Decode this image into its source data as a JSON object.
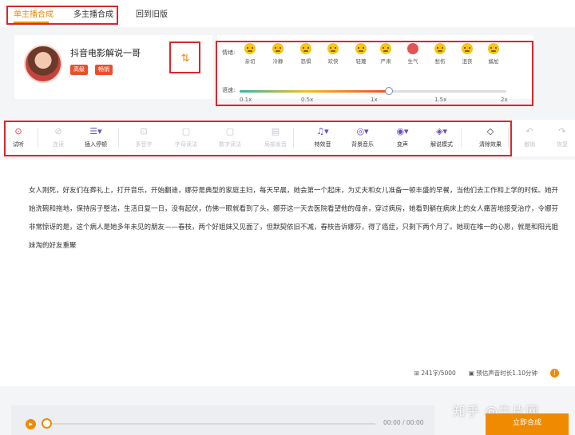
{
  "tabs": {
    "single": "单主播合成",
    "multi": "多主播合成",
    "old": "回到旧版"
  },
  "anchor": {
    "name": "抖音电影解说一哥",
    "badge_level": "高级",
    "badge_hot": "畅销",
    "swap_icon": "swap-arrows-icon"
  },
  "emotion": {
    "label": "情绪:",
    "items": [
      {
        "name": "亲切",
        "color": "#f5c518"
      },
      {
        "name": "冷静",
        "color": "#f5c518"
      },
      {
        "name": "恐惧",
        "color": "#f5c518"
      },
      {
        "name": "欢快",
        "color": "#f5c518"
      },
      {
        "name": "轻蔑",
        "color": "#f5c518"
      },
      {
        "name": "严肃",
        "color": "#f5c518"
      },
      {
        "name": "生气",
        "color": "#e45252"
      },
      {
        "name": "愁伤",
        "color": "#f5c518"
      },
      {
        "name": "沮丧",
        "color": "#f5c518"
      },
      {
        "name": "尴尬",
        "color": "#f5c518"
      }
    ]
  },
  "speed": {
    "label": "语速:",
    "ticks": [
      "0.1x",
      "0.5x",
      "1x",
      "1.5x",
      "2x"
    ],
    "value": "1.1x"
  },
  "toolbar": {
    "items": [
      {
        "label": "试听",
        "icon": "play-circle-icon",
        "state": "play"
      },
      {
        "label": "连读",
        "icon": "link-icon",
        "state": "dim"
      },
      {
        "label": "插入停顿",
        "icon": "pause-insert-icon",
        "state": "on"
      },
      {
        "label": "多音字",
        "icon": "polyphone-icon",
        "state": "dim"
      },
      {
        "label": "字母读法",
        "icon": "letter-read-icon",
        "state": "dim"
      },
      {
        "label": "数字读法",
        "icon": "number-read-icon",
        "state": "dim"
      },
      {
        "label": "局部发音",
        "icon": "partial-pron-icon",
        "state": "dim"
      },
      {
        "label": "特效音",
        "icon": "music-note-icon",
        "state": "on"
      },
      {
        "label": "背景音乐",
        "icon": "bg-music-icon",
        "state": "on"
      },
      {
        "label": "变声",
        "icon": "voice-change-icon",
        "state": "on"
      },
      {
        "label": "解说模式",
        "icon": "commentary-mode-icon",
        "state": "on"
      },
      {
        "label": "清除效果",
        "icon": "eraser-icon",
        "state": "on"
      },
      {
        "label": "撤销",
        "icon": "undo-icon",
        "state": "dim"
      },
      {
        "label": "恢复",
        "icon": "redo-icon",
        "state": "dim"
      }
    ]
  },
  "editor": {
    "text": "女人刚死，好友们在葬礼上，打开音乐，开始翻迪，娜芬是典型的家庭主妇，每天早晨，她会第一个起床，为丈夫和女儿准备一顿丰盛的早餐，当他们去工作和上学的时候。她开始洗碗和拖地，保持房子整洁，生活日复一日，没有起伏，仿佛一眼就看到了头。娜芬这一天去医院看望他的母亲，穿过病房，她看到躺在病床上的女人痛苦地接受治疗，令娜芬非常惊讶的是，这个病人是她多年未见的朋友——春枝，两个好姐妹又见面了，但默契依旧不减，春枝告诉娜芬，得了癌症，只剩下两个月了。她现在唯一的心愿，就是和阳光姐妹淘的好友重聚",
    "word_count": "241字/5000",
    "duration": "预估声音时长1.10分钟",
    "info_icon": "info-icon"
  },
  "player": {
    "time": "00:00 / 00:00",
    "play_icon": "play-icon"
  },
  "submit": {
    "label": "立即合成"
  },
  "watermark": "知乎 @牛片网",
  "colors": {
    "accent": "#f08a00",
    "highlight_box": "#d9262c",
    "badge": "#e8502c"
  }
}
